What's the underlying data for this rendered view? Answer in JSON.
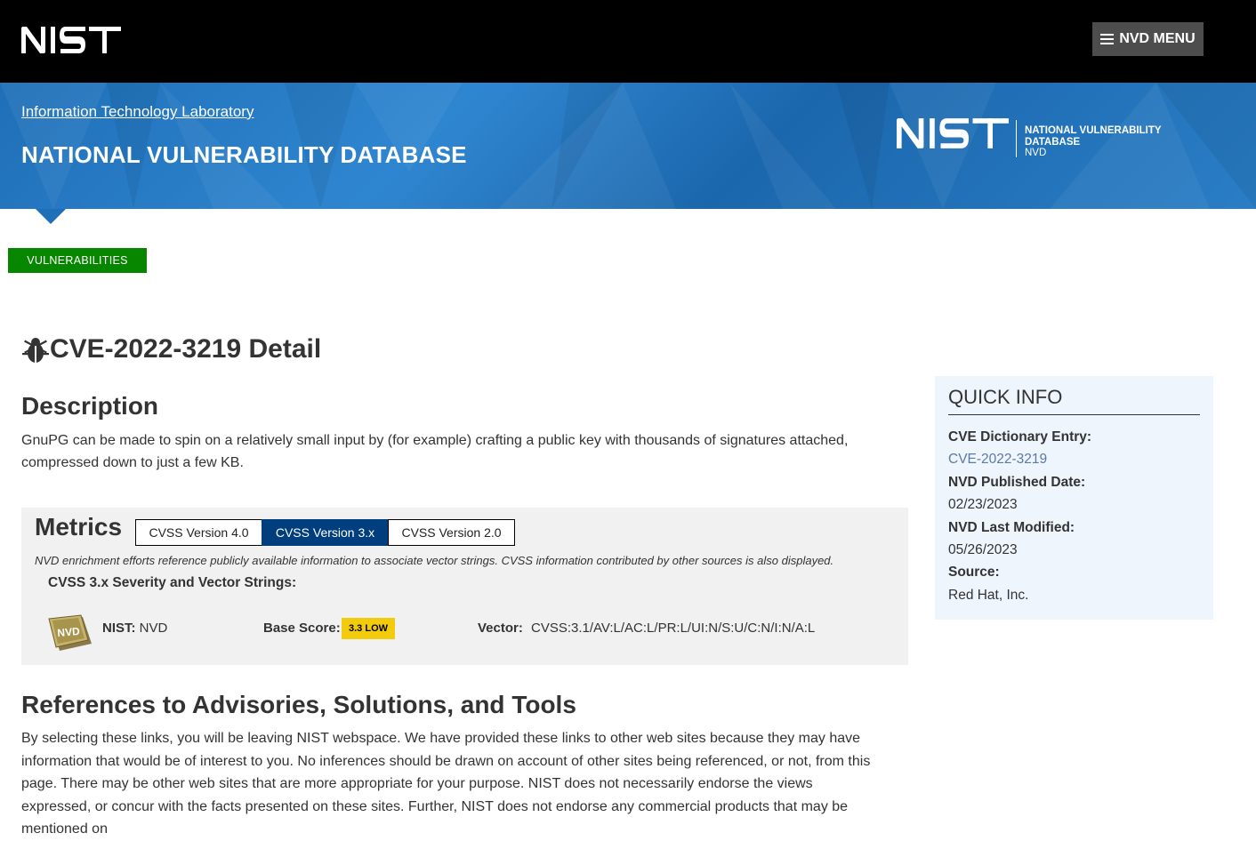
{
  "header": {
    "logo_text": "NIST",
    "menu_label": "NVD MENU"
  },
  "banner": {
    "lab_link": "Information Technology Laboratory",
    "title": "NATIONAL VULNERABILITY DATABASE",
    "logo_line1": "NATIONAL VULNERABILITY",
    "logo_line2": "DATABASE",
    "logo_line3": "NVD"
  },
  "section_tag": "VULNERABILITIES",
  "page": {
    "title": "CVE-2022-3219 Detail",
    "description_heading": "Description",
    "description": "GnuPG can be made to spin on a relatively small input by (for example) crafting a public key with thousands of signatures attached, compressed down to just a few KB."
  },
  "metrics": {
    "heading": "Metrics",
    "tabs": [
      {
        "label": "CVSS Version 4.0",
        "active": false
      },
      {
        "label": "CVSS Version 3.x",
        "active": true
      },
      {
        "label": "CVSS Version 2.0",
        "active": false
      }
    ],
    "note": "NVD enrichment efforts reference publicly available information to associate vector strings. CVSS information contributed by other sources is also displayed.",
    "severity_heading": "CVSS 3.x Severity and Vector Strings:",
    "source_label": "NIST:",
    "source_value": "NVD",
    "badge_text": "NVD",
    "base_score_label": "Base Score:",
    "base_score_value": "3.3 LOW",
    "vector_label": "Vector:",
    "vector_value": "CVSS:3.1/AV:L/AC:L/PR:L/UI:N/S:U/C:N/I:N/A:L"
  },
  "references": {
    "heading": "References to Advisories, Solutions, and Tools",
    "text": "By selecting these links, you will be leaving NIST webspace. We have provided these links to other web sites because they may have information that would be of interest to you. No inferences should be drawn on account of other sites being referenced, or not, from this page. There may be other web sites that are more appropriate for your purpose. NIST does not necessarily endorse the views expressed, or concur with the facts presented on these sites. Further, NIST does not endorse any commercial products that may be mentioned on"
  },
  "quick_info": {
    "title": "QUICK INFO",
    "items": [
      {
        "label": "CVE Dictionary Entry:",
        "value": "CVE-2022-3219"
      },
      {
        "label": "NVD Published Date:",
        "value": "02/23/2023"
      },
      {
        "label": "NVD Last Modified:",
        "value": "05/26/2023"
      },
      {
        "label": "Source:",
        "value": "Red Hat, Inc."
      }
    ]
  },
  "colors": {
    "banner_blue": "#1f6fb8",
    "tag_green": "#078700",
    "active_tab": "#003e7e",
    "score_low": "#f2cc0c",
    "quick_info_bg": "#eef5fc"
  }
}
